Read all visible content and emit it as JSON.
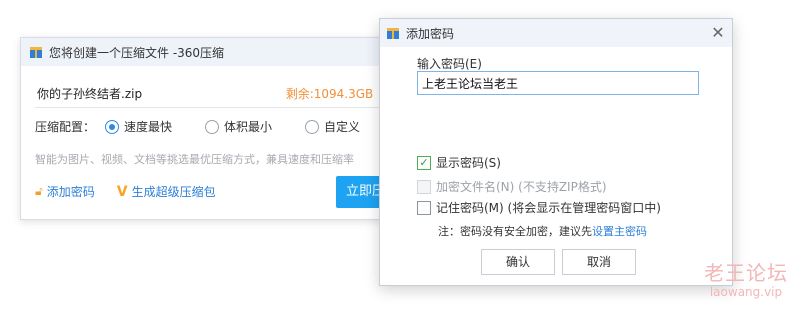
{
  "zip_window": {
    "title": "您将创建一个压缩文件 -360压缩",
    "filename": "你的子孙终结者.zip",
    "space_left": "剩余:1094.3GB",
    "config_label": "压缩配置：",
    "options": [
      {
        "label": "速度最快",
        "checked": true
      },
      {
        "label": "体积最小",
        "checked": false
      },
      {
        "label": "自定义",
        "checked": false
      }
    ],
    "hint": "智能为图片、视频、文档等挑选最优压缩方式，兼具速度和压缩率",
    "add_password": "添加密码",
    "super_zip": "生成超级压缩包",
    "start_button": "立即压缩"
  },
  "dialog": {
    "title": "添加密码",
    "input_label": "输入密码(E)",
    "password_value": "上老王论坛当老王",
    "show_password": {
      "label": "显示密码(S)",
      "checked": true
    },
    "encrypt_filenames": {
      "label": "加密文件名(N) (不支持ZIP格式)",
      "checked": false,
      "disabled": true
    },
    "remember_password": {
      "label": "记住密码(M) (将会显示在管理密码窗口中)",
      "checked": false
    },
    "note": "注：密码没有安全加密，建议先",
    "note_link": "设置主密码",
    "ok": "确认",
    "cancel": "取消"
  },
  "watermark": {
    "main": "老王论坛",
    "sub": "laowang.vip"
  },
  "colors": {
    "accent": "#2b8ae8",
    "start_button": "#1ea3f2",
    "space_text": "#f0903a",
    "check": "#4caf50",
    "watermark": "#f3b6b6"
  },
  "icons": [
    "zip-app-icon",
    "lock-icon",
    "v-icon",
    "dropdown-icon",
    "close-icon",
    "check-icon"
  ]
}
